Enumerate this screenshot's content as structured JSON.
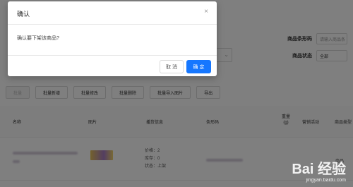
{
  "filters": {
    "barcode_label": "商品条形码",
    "barcode_placeholder": "请输入商品条",
    "status_label": "商品状态",
    "status_value": "全部"
  },
  "toolbar": {
    "buttons": [
      "批量",
      "批量新增",
      "批量修改",
      "批量删除",
      "批量导入图片",
      "导出"
    ]
  },
  "table": {
    "headers": {
      "name": "名称",
      "image": "图片",
      "spec": "播货信息",
      "barcode": "条形码",
      "weight": "重量(g)",
      "marketing": "营销活动",
      "type": "商品类型"
    },
    "row": {
      "spec_lines": [
        "价格：2",
        "库存：0",
        "状态：上架"
      ],
      "type": "商品"
    }
  },
  "dialog": {
    "title": "确认",
    "message": "确认要下架该商品?",
    "cancel": "取 消",
    "ok": "确 定"
  },
  "watermark": {
    "logo": "Bai 经验",
    "url": "jingyan.baidu.com"
  }
}
